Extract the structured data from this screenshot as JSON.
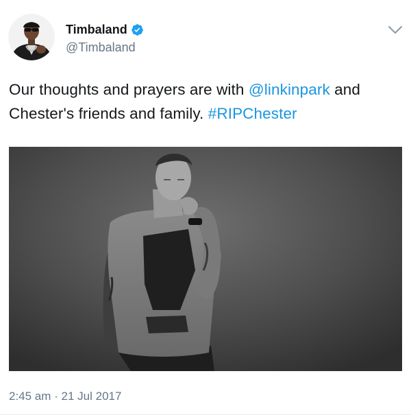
{
  "author": {
    "display_name": "Timbaland",
    "handle": "@Timbaland",
    "verified": true,
    "avatar": "person-avatar"
  },
  "tweet": {
    "text_parts": [
      {
        "type": "text",
        "value": "Our thoughts and prayers are with "
      },
      {
        "type": "mention",
        "value": "@linkinpark"
      },
      {
        "type": "text",
        "value": " and Chester's friends and family. "
      },
      {
        "type": "hashtag",
        "value": "#RIPChester"
      }
    ],
    "media": {
      "kind": "photo",
      "description_icon": "black-and-white-portrait"
    },
    "timestamp": "2:45 am · 21 Jul 2017"
  },
  "icons": {
    "verified": "verified-badge-icon",
    "menu": "chevron-down-icon"
  },
  "colors": {
    "link": "#1b95e0",
    "verified": "#1da1f2",
    "secondary_text": "#657786",
    "primary_text": "#14171a"
  }
}
